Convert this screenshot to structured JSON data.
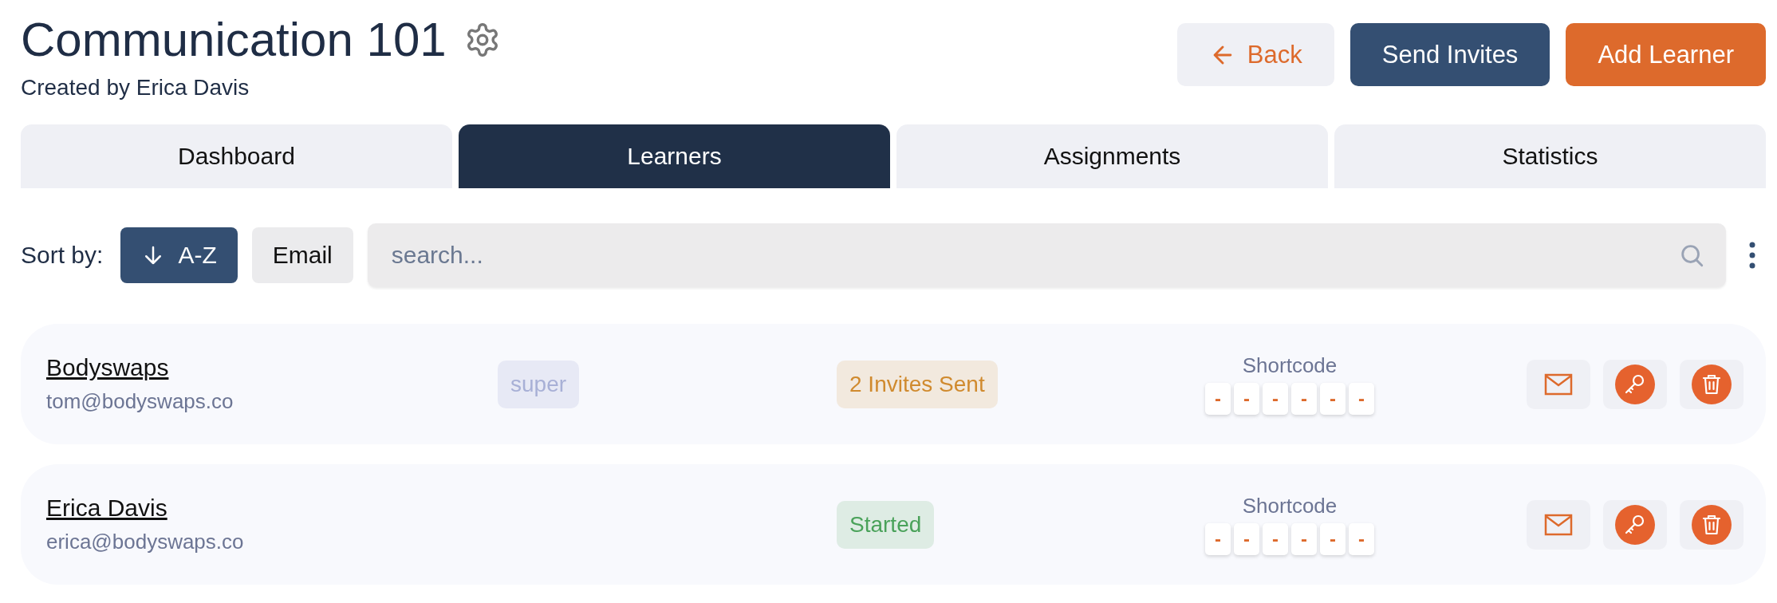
{
  "header": {
    "title": "Communication 101",
    "subtitle": "Created by Erica Davis"
  },
  "actions": [
    {
      "kind": "back",
      "label": "Back"
    },
    {
      "kind": "primary",
      "label": "Send Invites"
    },
    {
      "kind": "accent",
      "label": "Add Learner"
    }
  ],
  "tabs": [
    {
      "label": "Dashboard",
      "selected": false
    },
    {
      "label": "Learners",
      "selected": true
    },
    {
      "label": "Assignments",
      "selected": false
    },
    {
      "label": "Statistics",
      "selected": false
    }
  ],
  "sort": {
    "label": "Sort by:",
    "options": [
      {
        "label": "A-Z",
        "selected": true
      },
      {
        "label": "Email",
        "selected": false
      }
    ]
  },
  "search": {
    "placeholder": "search..."
  },
  "learners": [
    {
      "name": "Bodyswaps",
      "email": "tom@bodyswaps.co",
      "role": "super",
      "status": {
        "label": "2 Invites Sent",
        "color": "#d08a2e"
      },
      "shortcode": {
        "label": "Shortcode",
        "digits": [
          "-",
          "-",
          "-",
          "-",
          "-",
          "-"
        ]
      }
    },
    {
      "name": "Erica Davis",
      "email": "erica@bodyswaps.co",
      "status": {
        "label": "Started",
        "color": "#4aa25a"
      },
      "shortcode": {
        "label": "Shortcode",
        "digits": [
          "-",
          "-",
          "-",
          "-",
          "-",
          "-"
        ]
      }
    }
  ]
}
